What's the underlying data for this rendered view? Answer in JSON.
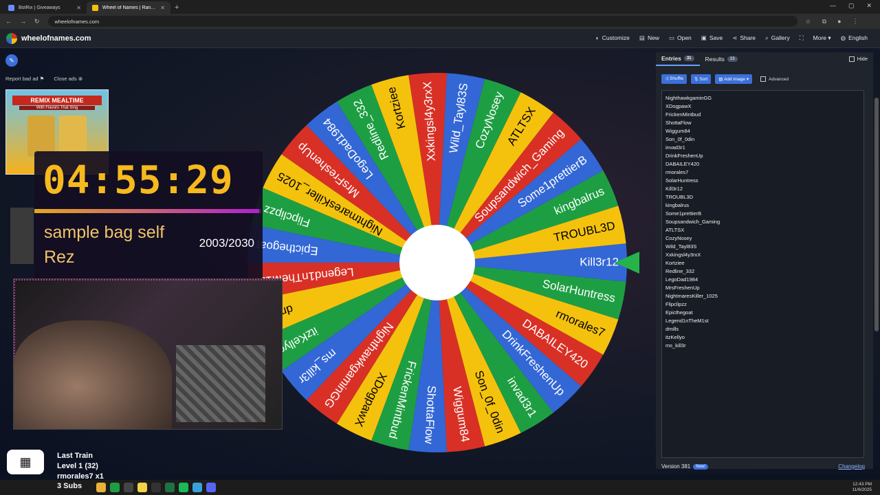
{
  "browser": {
    "tabs": [
      {
        "title": "BotRix | Giveaways"
      },
      {
        "title": "Wheel of Names | Random"
      }
    ],
    "url": "wheelofnames.com"
  },
  "header": {
    "site_name": "wheelofnames.com",
    "menu": [
      "Customize",
      "New",
      "Open",
      "Save",
      "Share",
      "Gallery",
      "More",
      "English"
    ]
  },
  "ads": {
    "report_label": "Report bad ad",
    "close_label": "Close ads",
    "headline": "REMIX MEALTIME",
    "subline": "With Flavors That Sing"
  },
  "overlay": {
    "timer": "04:55:29",
    "goal_line1": "sample bag self",
    "goal_line2": "Rez",
    "count": "2003/2030",
    "progress": 0.99
  },
  "stream": {
    "last_train_title": "Last Train",
    "last_train_level": "Level 1  (32)",
    "last_train_user": "rmorales7 x1",
    "subs": "3 Subs"
  },
  "panel": {
    "entries_tab": "Entries",
    "entries_count": "31",
    "results_tab": "Results",
    "results_count": "23",
    "hide_label": "Hide",
    "shuffle_label": "Shuffle",
    "sort_label": "Sort",
    "add_image_label": "Add image",
    "advanced_label": "Advanced",
    "entries": [
      "NighthawkgaminGG",
      "XDogpawX",
      "FrickenMintbud",
      "ShottaFlow",
      "Wiggum84",
      "Son_0f_0din",
      "invad3r1",
      "DrinkFreshenUp",
      "DABAILEY420",
      "rmorales7",
      "SolarHuntress",
      "Kill3r12",
      "TROUBL3D",
      "kingbalrus",
      "Some1prettierB",
      "Soupsandwich_Gaming",
      "ATLTSX",
      "CozyNosey",
      "Wild_Tayl83S",
      "Xxkingsl4y3rxX",
      "Kortziee",
      "Redline_332",
      "LegoDad1984",
      "MrsFreshenUp",
      "NightmaresKiller_1025",
      "Flipclipzz",
      "Epicthegoat",
      "Legend1nTheM1st",
      "dmills",
      "itzKellyo",
      "ms_kill3r"
    ],
    "version": "Version 381",
    "new_badge": "New!",
    "changelog": "Changelog"
  },
  "wheel": {
    "colors": [
      "#3367d6",
      "#1e9e43",
      "#f4c20d",
      "#d93025"
    ],
    "slices": [
      "Kill3r12",
      "SolarHuntress",
      "rmorales7",
      "DABAILEY420",
      "DrinkFreshenUp",
      "invad3r1",
      "Son_0f_0din",
      "Wiggum84",
      "ShottaFlow",
      "FrickenMintbud",
      "XDogpawX",
      "NighthawkgaminGG",
      "ms_kill3r",
      "itzKellyo",
      "dmills",
      "Legend1nTheM1st",
      "Epicthegoat",
      "Flipclipzz",
      "NightmaresKiller_1025",
      "MrsFreshenUp",
      "LegoDad1984",
      "Redline_332",
      "Kortziee",
      "Xxkingsl4y3rxX",
      "Wild_Tayl83S",
      "CozyNosey",
      "ATLTSX",
      "Soupsandwich_Gaming",
      "Some1prettierB",
      "kingbalrus",
      "TROUBL3D"
    ]
  },
  "taskbar": {
    "time": "12:43 PM",
    "date": "11/6/2025"
  }
}
